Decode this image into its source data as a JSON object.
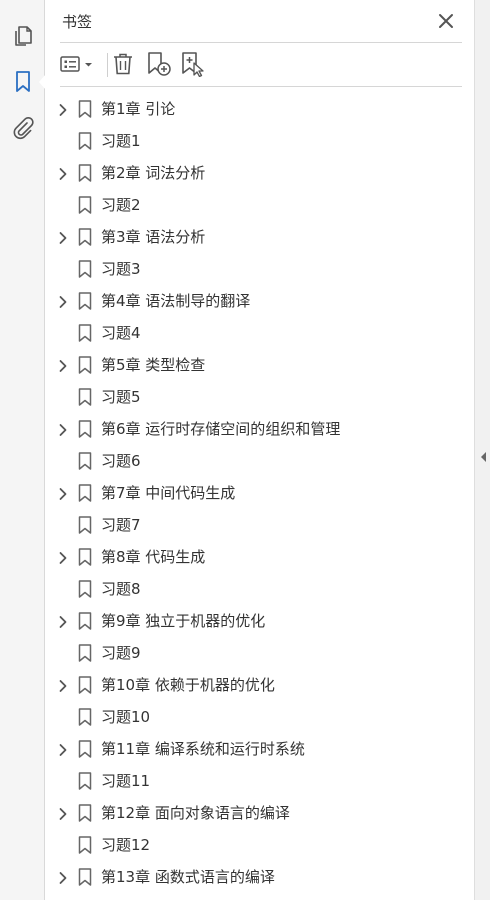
{
  "panel": {
    "title": "书签"
  },
  "rail": {
    "icons": [
      "pages-icon",
      "bookmark-icon",
      "attachment-icon"
    ],
    "active": "bookmark-icon",
    "accent": "#2b6fc2"
  },
  "toolbar": {
    "buttons": [
      "options-menu-icon",
      "delete-icon",
      "new-bookmark-icon",
      "new-bookmark-from-structure-icon"
    ]
  },
  "bookmarks": [
    {
      "label": "第1章 引论",
      "expandable": true
    },
    {
      "label": "习题1",
      "expandable": false
    },
    {
      "label": "第2章 词法分析",
      "expandable": true
    },
    {
      "label": "习题2",
      "expandable": false
    },
    {
      "label": "第3章 语法分析",
      "expandable": true
    },
    {
      "label": "习题3",
      "expandable": false
    },
    {
      "label": "第4章 语法制导的翻译",
      "expandable": true
    },
    {
      "label": "习题4",
      "expandable": false
    },
    {
      "label": "第5章 类型检查",
      "expandable": true
    },
    {
      "label": "习题5",
      "expandable": false
    },
    {
      "label": "第6章 运行时存储空间的组织和管理",
      "expandable": true
    },
    {
      "label": "习题6",
      "expandable": false
    },
    {
      "label": "第7章 中间代码生成",
      "expandable": true
    },
    {
      "label": "习题7",
      "expandable": false
    },
    {
      "label": "第8章 代码生成",
      "expandable": true
    },
    {
      "label": "习题8",
      "expandable": false
    },
    {
      "label": "第9章 独立于机器的优化",
      "expandable": true
    },
    {
      "label": "习题9",
      "expandable": false
    },
    {
      "label": "第10章 依赖于机器的优化",
      "expandable": true
    },
    {
      "label": "习题10",
      "expandable": false
    },
    {
      "label": "第11章 编译系统和运行时系统",
      "expandable": true
    },
    {
      "label": "习题11",
      "expandable": false
    },
    {
      "label": "第12章 面向对象语言的编译",
      "expandable": true
    },
    {
      "label": "习题12",
      "expandable": false
    },
    {
      "label": "第13章 函数式语言的编译",
      "expandable": true
    }
  ]
}
